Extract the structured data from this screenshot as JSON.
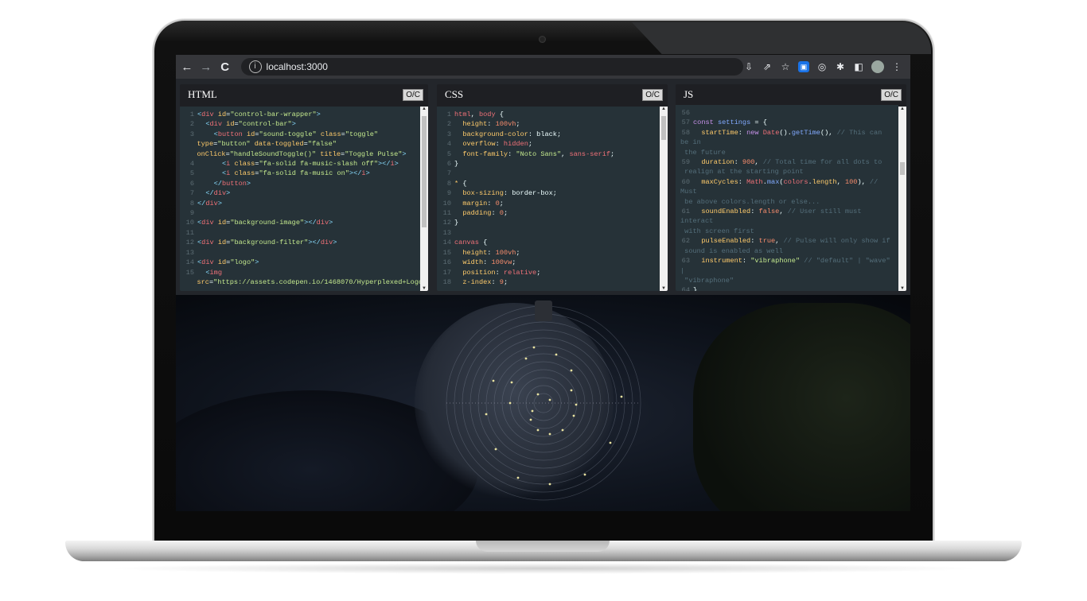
{
  "browser": {
    "url": "localhost:3000",
    "nav": {
      "back": "←",
      "forward": "→",
      "reload": "C"
    }
  },
  "panels": {
    "html": {
      "title": "HTML",
      "oc": "O/C"
    },
    "css": {
      "title": "CSS",
      "oc": "O/C"
    },
    "js": {
      "title": "JS",
      "oc": "O/C"
    }
  },
  "colors": {
    "chrome_bar": "#35363a",
    "editor_bg": "#263238",
    "panel_bg": "#1e1f23"
  },
  "icons": [
    "back-icon",
    "forward-icon",
    "reload-icon",
    "info-icon",
    "install-icon",
    "share-icon",
    "star-icon",
    "extension-icon",
    "puzzle-icon",
    "sidebar-icon",
    "avatar",
    "menu-icon"
  ]
}
